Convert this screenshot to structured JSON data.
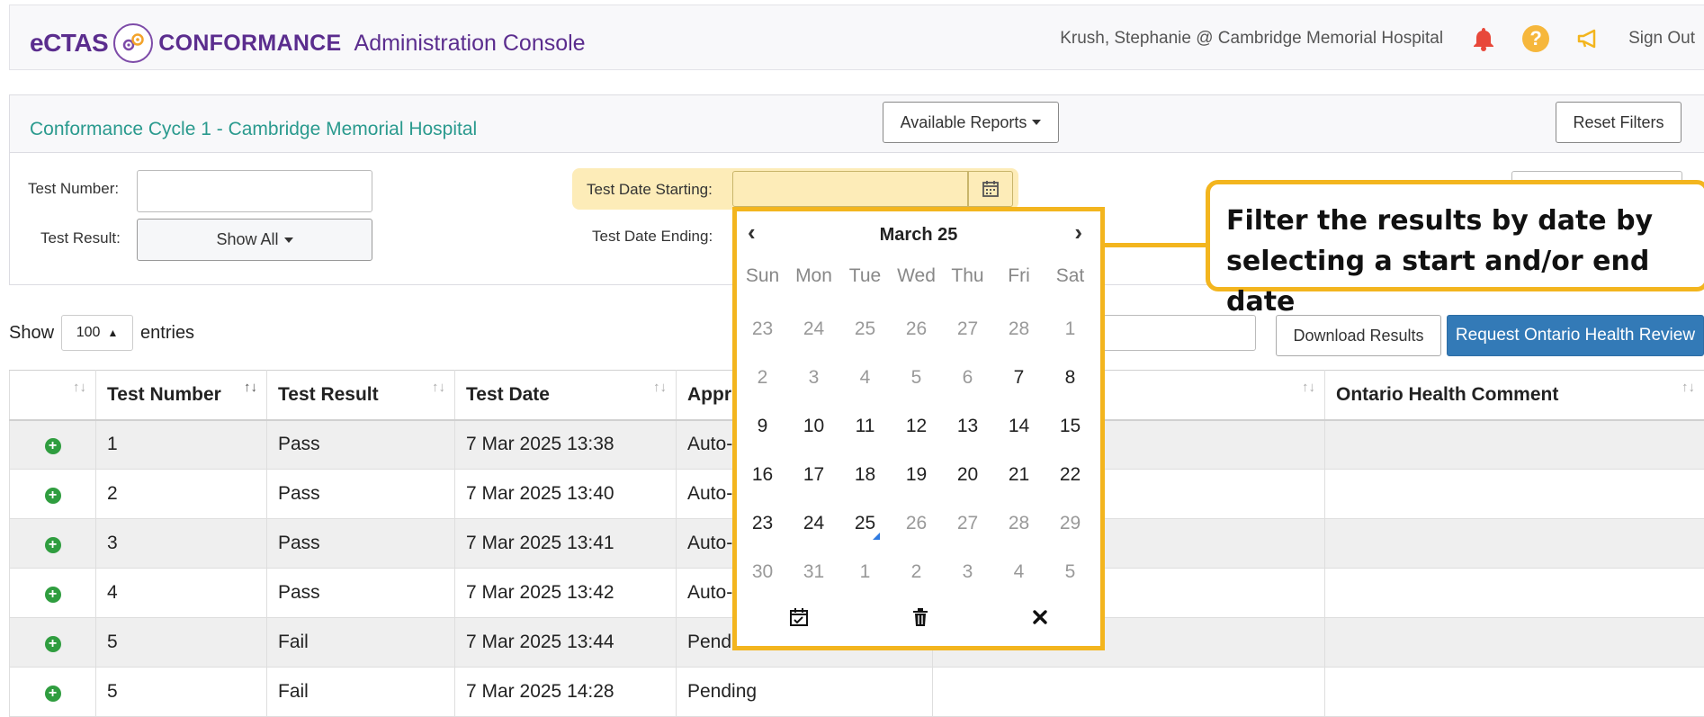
{
  "header": {
    "brand_ectas": "eCTAS",
    "brand_conformance": "CONFORMANCE",
    "brand_console": "Administration Console",
    "user": "Krush, Stephanie @ Cambridge Memorial Hospital",
    "sign_out": "Sign Out",
    "help_glyph": "?"
  },
  "panel": {
    "title": "Conformance Cycle 1 - Cambridge Memorial Hospital",
    "available_reports": "Available Reports",
    "reset_filters": "Reset Filters",
    "test_number_label": "Test Number:",
    "test_number_value": "",
    "test_result_label": "Test Result:",
    "test_result_value": "Show All",
    "date_start_label": "Test Date Starting:",
    "date_start_value": "",
    "date_end_label": "Test Date Ending:"
  },
  "list_controls": {
    "show_label": "Show",
    "entries_value": "100",
    "entries_label": "entries",
    "download_results": "Download Results",
    "request_review": "Request Ontario Health Review"
  },
  "table": {
    "columns": [
      "",
      "Test Number",
      "Test Result",
      "Test Date",
      "Appr",
      "",
      "Ontario Health Comment"
    ],
    "rows": [
      {
        "number": "1",
        "result": "Pass",
        "date": "7 Mar 2025 13:38",
        "approval": "Auto-"
      },
      {
        "number": "2",
        "result": "Pass",
        "date": "7 Mar 2025 13:40",
        "approval": "Auto-"
      },
      {
        "number": "3",
        "result": "Pass",
        "date": "7 Mar 2025 13:41",
        "approval": "Auto-"
      },
      {
        "number": "4",
        "result": "Pass",
        "date": "7 Mar 2025 13:42",
        "approval": "Auto-"
      },
      {
        "number": "5",
        "result": "Fail",
        "date": "7 Mar 2025 13:44",
        "approval": "Pend"
      },
      {
        "number": "5",
        "result": "Fail",
        "date": "7 Mar 2025 14:28",
        "approval": "Pending"
      }
    ]
  },
  "calendar": {
    "title": "March 25",
    "weekdays": [
      "Sun",
      "Mon",
      "Tue",
      "Wed",
      "Thu",
      "Fri",
      "Sat"
    ],
    "weeks": [
      [
        "23",
        "24",
        "25",
        "26",
        "27",
        "28",
        "1"
      ],
      [
        "2",
        "3",
        "4",
        "5",
        "6",
        "7",
        "8"
      ],
      [
        "9",
        "10",
        "11",
        "12",
        "13",
        "14",
        "15"
      ],
      [
        "16",
        "17",
        "18",
        "19",
        "20",
        "21",
        "22"
      ],
      [
        "23",
        "24",
        "25",
        "26",
        "27",
        "28",
        "29"
      ],
      [
        "30",
        "31",
        "1",
        "2",
        "3",
        "4",
        "5"
      ]
    ]
  },
  "callout": {
    "line1": "Filter the results by date by",
    "line2": "selecting a start and/or end date"
  },
  "colors": {
    "brand": "#5b2d8e",
    "teal": "#2a9a8e",
    "accent_blue": "#337ab7",
    "highlight": "#f3b51e",
    "success": "#2f9d3f"
  }
}
